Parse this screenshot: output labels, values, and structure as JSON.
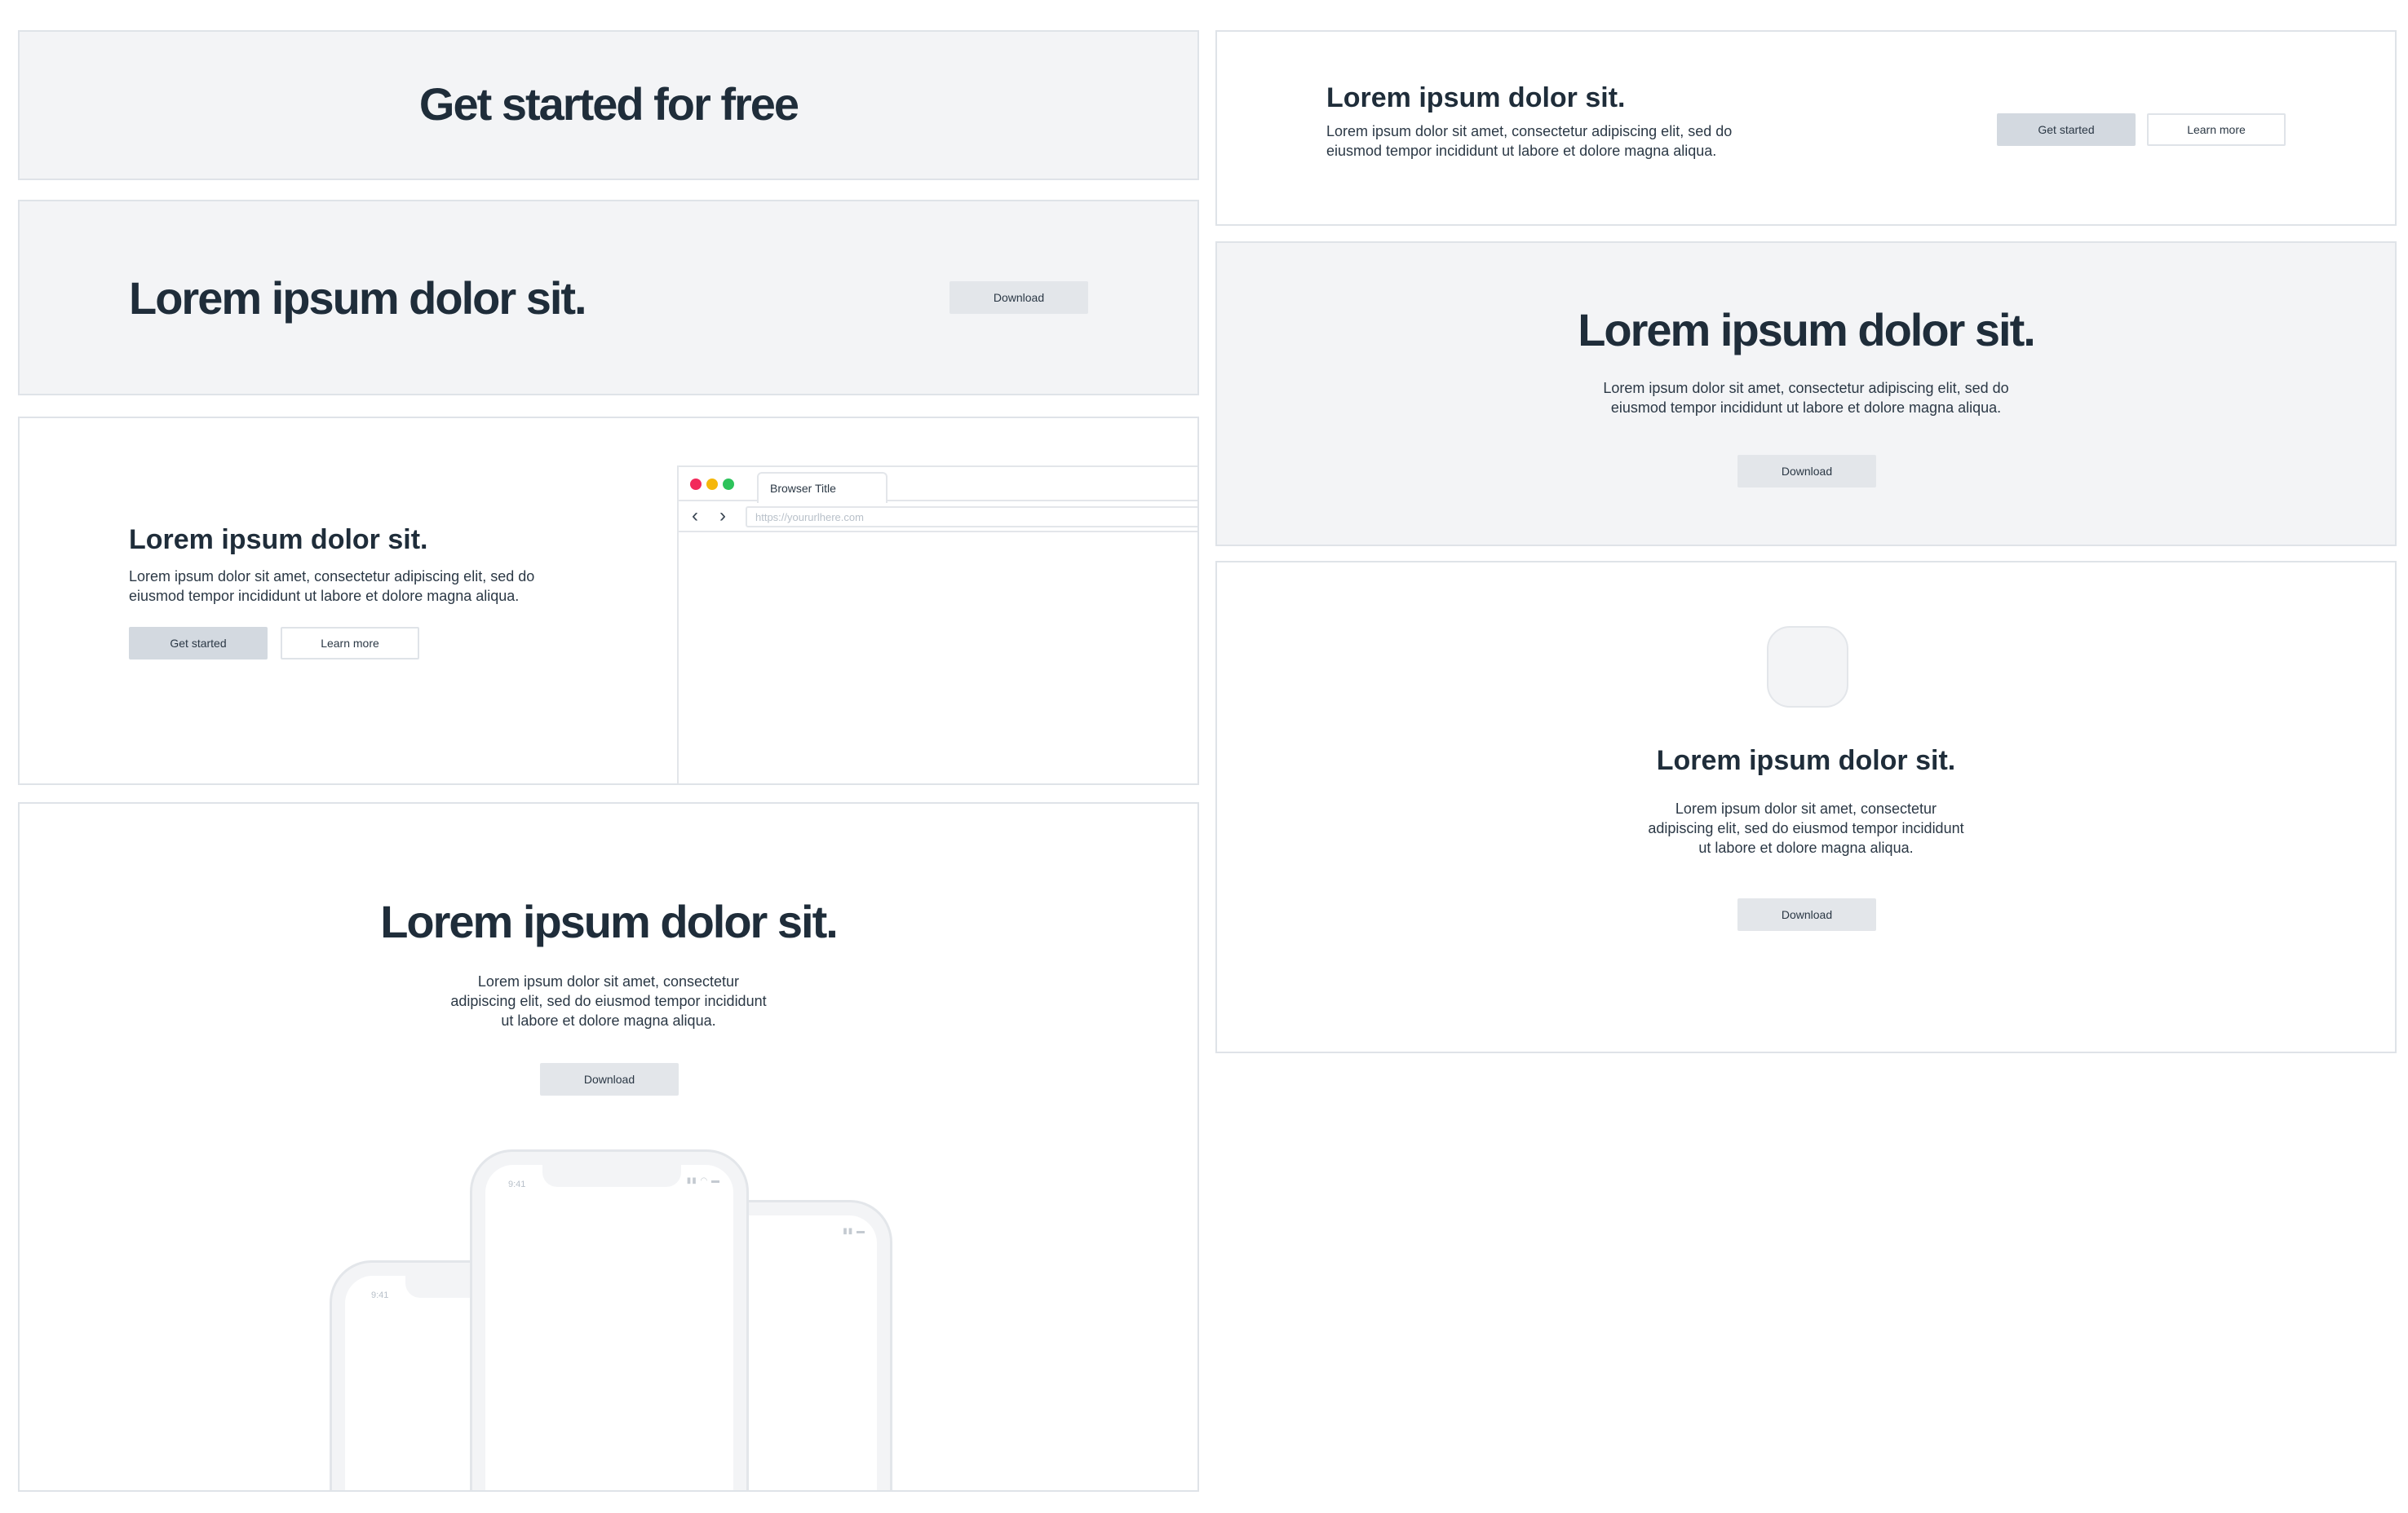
{
  "card1": {
    "title": "Get started for free"
  },
  "card2": {
    "title": "Lorem ipsum dolor sit.",
    "button": "Download"
  },
  "card3": {
    "title": "Lorem ipsum dolor sit.",
    "body_line1": "Lorem ipsum dolor sit amet, consectetur adipiscing elit, sed do",
    "body_line2": "eiusmod tempor incididunt ut labore et dolore magna aliqua.",
    "primary_button": "Get started",
    "secondary_button": "Learn more",
    "browser": {
      "tab_title": "Browser Title",
      "url_placeholder": "https://yoururlhere.com"
    }
  },
  "card4": {
    "title": "Lorem ipsum dolor sit.",
    "body_line1": "Lorem ipsum dolor sit amet, consectetur",
    "body_line2": "adipiscing elit, sed do eiusmod tempor incididunt",
    "body_line3": "ut labore et dolore magna aliqua.",
    "button": "Download",
    "phone_time": "9:41"
  },
  "card5": {
    "title": "Lorem ipsum dolor sit.",
    "body_line1": "Lorem ipsum dolor sit amet, consectetur adipiscing elit, sed do",
    "body_line2": "eiusmod tempor incididunt ut labore et dolore magna aliqua.",
    "primary_button": "Get started",
    "secondary_button": "Learn more"
  },
  "card6": {
    "title": "Lorem ipsum dolor sit.",
    "body_line1": "Lorem ipsum dolor sit amet, consectetur adipiscing elit, sed do",
    "body_line2": "eiusmod tempor incididunt ut labore et dolore magna aliqua.",
    "button": "Download"
  },
  "card7": {
    "title": "Lorem ipsum dolor sit.",
    "body_line1": "Lorem ipsum dolor sit amet, consectetur",
    "body_line2": "adipiscing elit, sed do eiusmod tempor incididunt",
    "body_line3": "ut labore et dolore magna aliqua.",
    "button": "Download"
  },
  "colors": {
    "heading": "#1f2d3a",
    "card_grey": "#f3f4f6",
    "border": "#dfe3e8",
    "button_fill": "#e3e6ea",
    "dot_red": "#f2295a",
    "dot_yellow": "#f5b70a",
    "dot_green": "#2dc35b"
  },
  "icons": [
    "chevron-left-icon",
    "chevron-right-icon",
    "signal-icon",
    "wifi-icon",
    "battery-icon"
  ]
}
